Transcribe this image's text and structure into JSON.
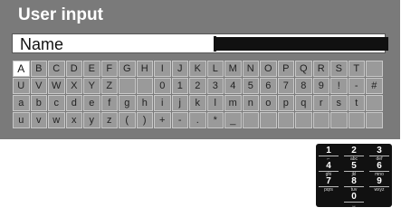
{
  "dialog": {
    "title": "User input",
    "field_label": "Name"
  },
  "keyboard": {
    "rows": [
      [
        "A",
        "B",
        "C",
        "D",
        "E",
        "F",
        "G",
        "H",
        "I",
        "J",
        "K",
        "L",
        "M",
        "N",
        "O",
        "P",
        "Q",
        "R",
        "S",
        "T",
        ""
      ],
      [
        "U",
        "V",
        "W",
        "X",
        "Y",
        "Z",
        "",
        "",
        "0",
        "1",
        "2",
        "3",
        "4",
        "5",
        "6",
        "7",
        "8",
        "9",
        "!",
        "-",
        "#"
      ],
      [
        "a",
        "b",
        "c",
        "d",
        "e",
        "f",
        "g",
        "h",
        "i",
        "j",
        "k",
        "l",
        "m",
        "n",
        "o",
        "p",
        "q",
        "r",
        "s",
        "t",
        ""
      ],
      [
        "u",
        "v",
        "w",
        "x",
        "y",
        "z",
        "(",
        ")",
        "+",
        "-",
        ".",
        "*",
        "_",
        "",
        "",
        "",
        "",
        "",
        "",
        "",
        ""
      ]
    ],
    "selected_key": "A"
  },
  "numpad": {
    "keys": [
      {
        "digit": "1",
        "sub": "⌐"
      },
      {
        "digit": "2",
        "sub": "abc"
      },
      {
        "digit": "3",
        "sub": "def"
      },
      {
        "digit": "4",
        "sub": "ghi"
      },
      {
        "digit": "5",
        "sub": "jkl"
      },
      {
        "digit": "6",
        "sub": "mno"
      },
      {
        "digit": "7",
        "sub": "pqrs"
      },
      {
        "digit": "8",
        "sub": "tuv"
      },
      {
        "digit": "9",
        "sub": "wxyz"
      },
      {
        "digit": "0",
        "sub": "␣"
      }
    ]
  }
}
